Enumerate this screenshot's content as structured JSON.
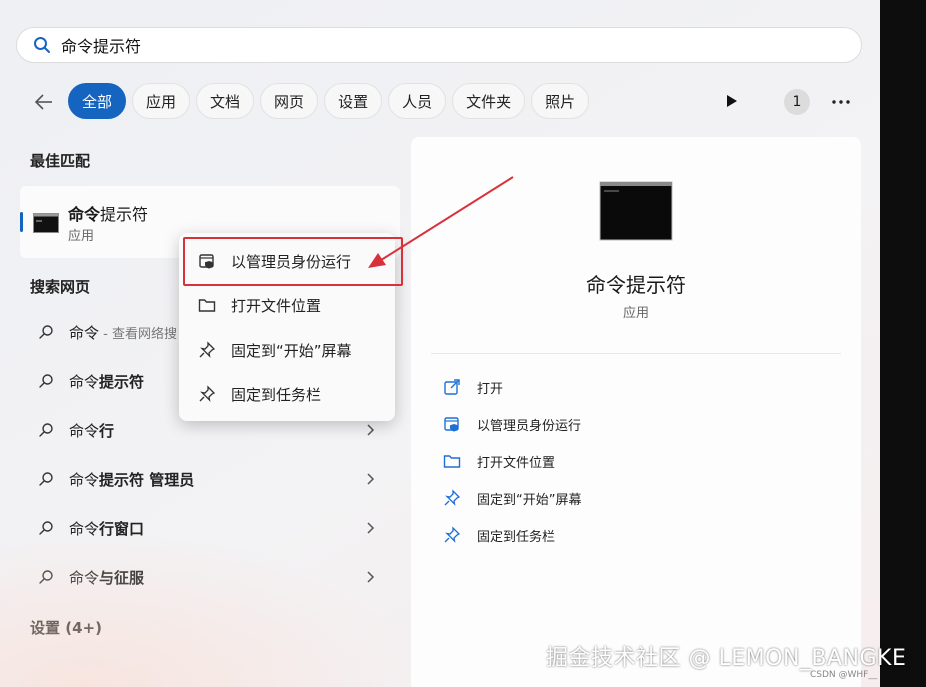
{
  "search": {
    "value": "命令提示符"
  },
  "filters": [
    "全部",
    "应用",
    "文档",
    "网页",
    "设置",
    "人员",
    "文件夹",
    "照片"
  ],
  "badge": "1",
  "best_match": {
    "heading": "最佳匹配",
    "title_bold": "命令",
    "title_rest": "提示符",
    "subtitle": "应用"
  },
  "web_search": {
    "heading": "搜索网页",
    "items": [
      {
        "query": "命令",
        "bold": "",
        "sub": " - 查看网络搜"
      },
      {
        "query": "命令",
        "bold": "提示符",
        "sub": ""
      },
      {
        "query": "命令",
        "bold": "行",
        "sub": ""
      },
      {
        "query": "命令",
        "bold": "提示符 管理员",
        "sub": ""
      },
      {
        "query": "命令",
        "bold": "行窗口",
        "sub": ""
      },
      {
        "query": "命令",
        "bold": "与征服",
        "sub": ""
      }
    ]
  },
  "settings_heading": "设置 (4+)",
  "context_menu": [
    {
      "label": "以管理员身份运行",
      "icon": "shield-icon"
    },
    {
      "label": "打开文件位置",
      "icon": "folder-icon"
    },
    {
      "label": "固定到“开始”屏幕",
      "icon": "pin-icon"
    },
    {
      "label": "固定到任务栏",
      "icon": "pin-icon"
    }
  ],
  "detail": {
    "title": "命令提示符",
    "subtitle": "应用",
    "actions": [
      {
        "label": "打开",
        "icon": "open-icon"
      },
      {
        "label": "以管理员身份运行",
        "icon": "shield-icon"
      },
      {
        "label": "打开文件位置",
        "icon": "folder-icon"
      },
      {
        "label": "固定到“开始”屏幕",
        "icon": "pin-icon"
      },
      {
        "label": "固定到任务栏",
        "icon": "pin-icon"
      }
    ]
  },
  "watermark": "掘金技术社区 @ LEMON_BANGKE",
  "csdn": "CSDN @WHF__",
  "colors": {
    "accent": "#1565c0",
    "annotation": "#d9313a"
  }
}
